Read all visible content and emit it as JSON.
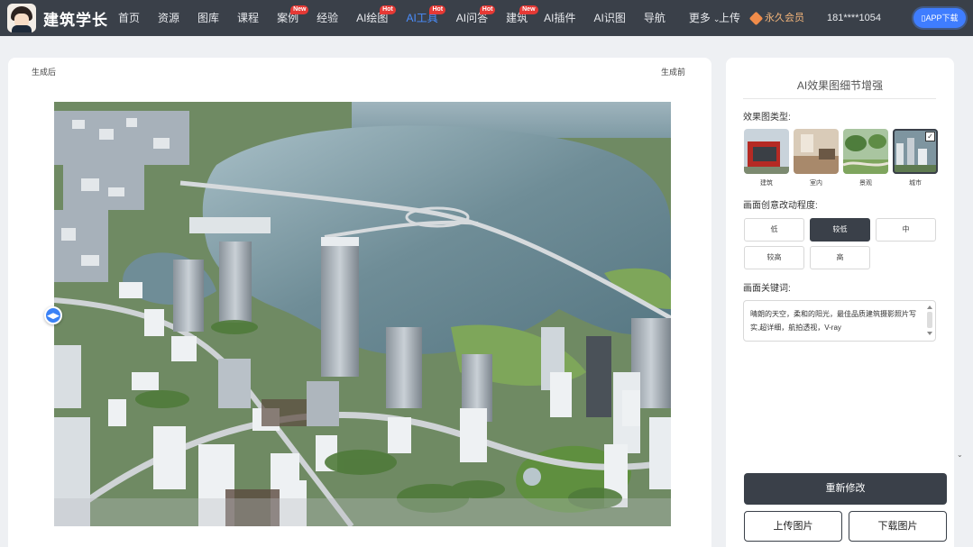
{
  "brand": {
    "name": "建筑学长"
  },
  "nav": {
    "items": [
      {
        "label": "首页",
        "badge": ""
      },
      {
        "label": "资源",
        "badge": ""
      },
      {
        "label": "图库",
        "badge": ""
      },
      {
        "label": "课程",
        "badge": ""
      },
      {
        "label": "案例",
        "badge": "New"
      },
      {
        "label": "经验",
        "badge": ""
      },
      {
        "label": "AI绘图",
        "badge": "Hot"
      },
      {
        "label": "AI工具",
        "badge": "Hot",
        "active": true
      },
      {
        "label": "AI问答",
        "badge": "Hot"
      },
      {
        "label": "建筑",
        "badge": "New"
      },
      {
        "label": "AI插件",
        "badge": ""
      },
      {
        "label": "AI识图",
        "badge": ""
      },
      {
        "label": "导航",
        "badge": ""
      },
      {
        "label": "更多",
        "badge": ""
      }
    ],
    "upload": "上传",
    "vip": "永久会员",
    "phone": "181****1054",
    "app": "APP下载"
  },
  "compare": {
    "left_label": "生成后",
    "right_label": "生成前"
  },
  "panel": {
    "title": "AI效果图细节增强",
    "type_label": "效果图类型:",
    "types": [
      "建筑",
      "室内",
      "景观",
      "城市"
    ],
    "level_label": "画面创意改动程度:",
    "levels": [
      "低",
      "较低",
      "中",
      "较高",
      "高"
    ],
    "prompt_label": "画面关键词:",
    "prompt_text": "晴朗的天空，柔和的阳光，最佳品质建筑摄影照片写实,超详细，航拍透视，V-ray",
    "regenerate": "重新修改",
    "upload_image": "上传图片",
    "download_image": "下载图片"
  },
  "colors": {
    "topbar": "#3a4049",
    "accent": "#3f7dff",
    "badge": "#e53935",
    "vip": "#f2b47a",
    "dark_button": "#3a4049"
  }
}
